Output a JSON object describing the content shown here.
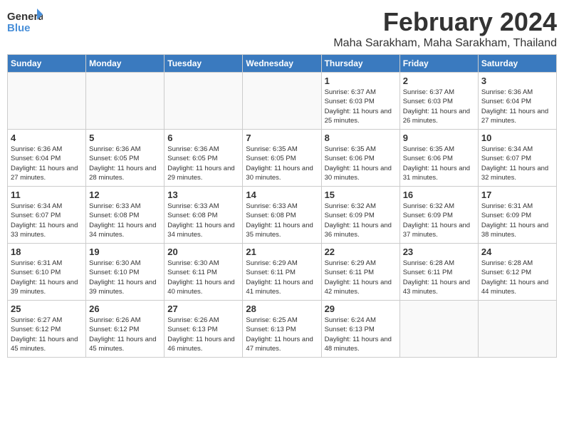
{
  "logo": {
    "text_general": "General",
    "text_blue": "Blue"
  },
  "calendar": {
    "title": "February 2024",
    "subtitle": "Maha Sarakham, Maha Sarakham, Thailand",
    "headers": [
      "Sunday",
      "Monday",
      "Tuesday",
      "Wednesday",
      "Thursday",
      "Friday",
      "Saturday"
    ],
    "weeks": [
      [
        {
          "day": "",
          "info": ""
        },
        {
          "day": "",
          "info": ""
        },
        {
          "day": "",
          "info": ""
        },
        {
          "day": "",
          "info": ""
        },
        {
          "day": "1",
          "info": "Sunrise: 6:37 AM\nSunset: 6:03 PM\nDaylight: 11 hours and 25 minutes."
        },
        {
          "day": "2",
          "info": "Sunrise: 6:37 AM\nSunset: 6:03 PM\nDaylight: 11 hours and 26 minutes."
        },
        {
          "day": "3",
          "info": "Sunrise: 6:36 AM\nSunset: 6:04 PM\nDaylight: 11 hours and 27 minutes."
        }
      ],
      [
        {
          "day": "4",
          "info": "Sunrise: 6:36 AM\nSunset: 6:04 PM\nDaylight: 11 hours and 27 minutes."
        },
        {
          "day": "5",
          "info": "Sunrise: 6:36 AM\nSunset: 6:05 PM\nDaylight: 11 hours and 28 minutes."
        },
        {
          "day": "6",
          "info": "Sunrise: 6:36 AM\nSunset: 6:05 PM\nDaylight: 11 hours and 29 minutes."
        },
        {
          "day": "7",
          "info": "Sunrise: 6:35 AM\nSunset: 6:05 PM\nDaylight: 11 hours and 30 minutes."
        },
        {
          "day": "8",
          "info": "Sunrise: 6:35 AM\nSunset: 6:06 PM\nDaylight: 11 hours and 30 minutes."
        },
        {
          "day": "9",
          "info": "Sunrise: 6:35 AM\nSunset: 6:06 PM\nDaylight: 11 hours and 31 minutes."
        },
        {
          "day": "10",
          "info": "Sunrise: 6:34 AM\nSunset: 6:07 PM\nDaylight: 11 hours and 32 minutes."
        }
      ],
      [
        {
          "day": "11",
          "info": "Sunrise: 6:34 AM\nSunset: 6:07 PM\nDaylight: 11 hours and 33 minutes."
        },
        {
          "day": "12",
          "info": "Sunrise: 6:33 AM\nSunset: 6:08 PM\nDaylight: 11 hours and 34 minutes."
        },
        {
          "day": "13",
          "info": "Sunrise: 6:33 AM\nSunset: 6:08 PM\nDaylight: 11 hours and 34 minutes."
        },
        {
          "day": "14",
          "info": "Sunrise: 6:33 AM\nSunset: 6:08 PM\nDaylight: 11 hours and 35 minutes."
        },
        {
          "day": "15",
          "info": "Sunrise: 6:32 AM\nSunset: 6:09 PM\nDaylight: 11 hours and 36 minutes."
        },
        {
          "day": "16",
          "info": "Sunrise: 6:32 AM\nSunset: 6:09 PM\nDaylight: 11 hours and 37 minutes."
        },
        {
          "day": "17",
          "info": "Sunrise: 6:31 AM\nSunset: 6:09 PM\nDaylight: 11 hours and 38 minutes."
        }
      ],
      [
        {
          "day": "18",
          "info": "Sunrise: 6:31 AM\nSunset: 6:10 PM\nDaylight: 11 hours and 39 minutes."
        },
        {
          "day": "19",
          "info": "Sunrise: 6:30 AM\nSunset: 6:10 PM\nDaylight: 11 hours and 39 minutes."
        },
        {
          "day": "20",
          "info": "Sunrise: 6:30 AM\nSunset: 6:11 PM\nDaylight: 11 hours and 40 minutes."
        },
        {
          "day": "21",
          "info": "Sunrise: 6:29 AM\nSunset: 6:11 PM\nDaylight: 11 hours and 41 minutes."
        },
        {
          "day": "22",
          "info": "Sunrise: 6:29 AM\nSunset: 6:11 PM\nDaylight: 11 hours and 42 minutes."
        },
        {
          "day": "23",
          "info": "Sunrise: 6:28 AM\nSunset: 6:11 PM\nDaylight: 11 hours and 43 minutes."
        },
        {
          "day": "24",
          "info": "Sunrise: 6:28 AM\nSunset: 6:12 PM\nDaylight: 11 hours and 44 minutes."
        }
      ],
      [
        {
          "day": "25",
          "info": "Sunrise: 6:27 AM\nSunset: 6:12 PM\nDaylight: 11 hours and 45 minutes."
        },
        {
          "day": "26",
          "info": "Sunrise: 6:26 AM\nSunset: 6:12 PM\nDaylight: 11 hours and 45 minutes."
        },
        {
          "day": "27",
          "info": "Sunrise: 6:26 AM\nSunset: 6:13 PM\nDaylight: 11 hours and 46 minutes."
        },
        {
          "day": "28",
          "info": "Sunrise: 6:25 AM\nSunset: 6:13 PM\nDaylight: 11 hours and 47 minutes."
        },
        {
          "day": "29",
          "info": "Sunrise: 6:24 AM\nSunset: 6:13 PM\nDaylight: 11 hours and 48 minutes."
        },
        {
          "day": "",
          "info": ""
        },
        {
          "day": "",
          "info": ""
        }
      ]
    ]
  }
}
